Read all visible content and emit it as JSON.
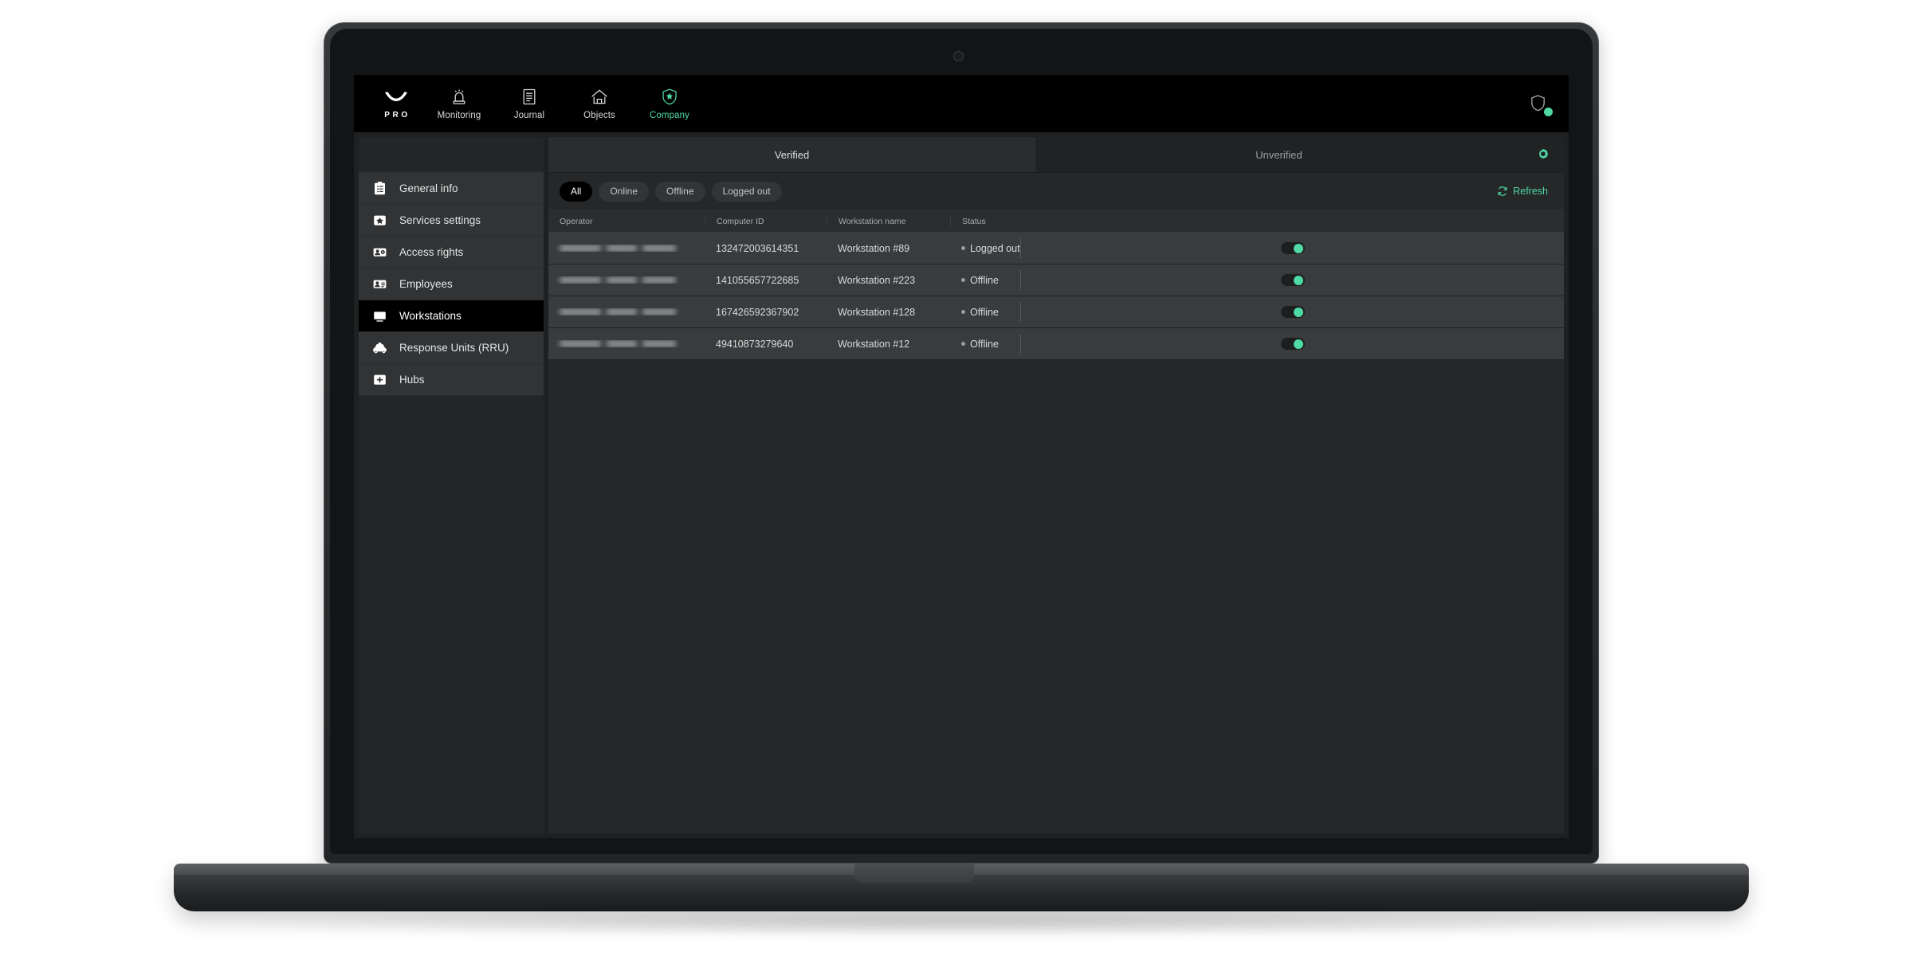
{
  "topnav": {
    "brand": {
      "word": "PRO",
      "icon": "chevron-brand-logo"
    },
    "items": [
      {
        "label": "Monitoring",
        "icon": "siren-icon",
        "active": false
      },
      {
        "label": "Journal",
        "icon": "document-icon",
        "active": false
      },
      {
        "label": "Objects",
        "icon": "house-icon",
        "active": false
      },
      {
        "label": "Company",
        "icon": "shield-star-icon",
        "active": true
      }
    ],
    "right": {
      "icon": "shield-icon",
      "badge_color": "#4fd9a4"
    }
  },
  "sidebar": {
    "items": [
      {
        "label": "General info",
        "icon": "clipboard-list-icon",
        "selected": false
      },
      {
        "label": "Services settings",
        "icon": "star-badge-icon",
        "selected": false
      },
      {
        "label": "Access rights",
        "icon": "user-gear-card-icon",
        "selected": false
      },
      {
        "label": "Employees",
        "icon": "id-card-icon",
        "selected": false
      },
      {
        "label": "Workstations",
        "icon": "monitor-icon",
        "selected": true
      },
      {
        "label": "Response Units (RRU)",
        "icon": "car-icon",
        "selected": false
      },
      {
        "label": "Hubs",
        "icon": "plus-square-icon",
        "selected": false
      }
    ]
  },
  "main": {
    "tabs": [
      {
        "label": "Verified",
        "active": true
      },
      {
        "label": "Unverified",
        "active": false
      }
    ],
    "settings_icon": "gear-icon",
    "filters": {
      "chips": [
        {
          "label": "All",
          "active": true
        },
        {
          "label": "Online",
          "active": false
        },
        {
          "label": "Offline",
          "active": false
        },
        {
          "label": "Logged out",
          "active": false
        }
      ],
      "refresh_label": "Refresh",
      "refresh_icon": "refresh-icon"
    },
    "table": {
      "columns": [
        "Operator",
        "Computer ID",
        "Workstation name",
        "Status",
        ""
      ],
      "rows": [
        {
          "operator": "",
          "computer_id": "132472003614351",
          "workstation": "Workstation #89",
          "status": "Logged out",
          "toggle_on": true
        },
        {
          "operator": "",
          "computer_id": "141055657722685",
          "workstation": "Workstation #223",
          "status": "Offline",
          "toggle_on": true
        },
        {
          "operator": "",
          "computer_id": "167426592367902",
          "workstation": "Workstation #128",
          "status": "Offline",
          "toggle_on": true
        },
        {
          "operator": "",
          "computer_id": "49410873279640",
          "workstation": "Workstation #12",
          "status": "Offline",
          "toggle_on": true
        }
      ]
    }
  },
  "colors": {
    "accent_green": "#4fd9a4",
    "screen_bg": "#1f2021",
    "panel_bg": "#262728",
    "row_bg": "#3a3b3c",
    "topbar_bg": "#000000"
  }
}
